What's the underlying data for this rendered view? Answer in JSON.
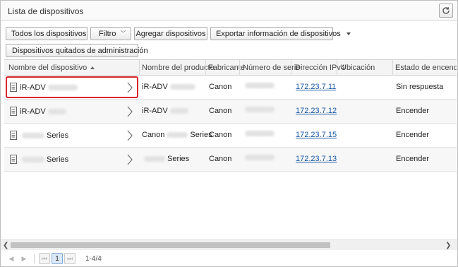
{
  "window": {
    "title": "Lista de dispositivos"
  },
  "toolbar": {
    "all_devices": "Todos los dispositivos",
    "filter": "Filtro",
    "add_devices": "Agregar dispositivos",
    "export": "Exportar información de dispositivos",
    "removed_devices": "Dispositivos quitados de administración"
  },
  "columns": [
    "Nombre del dispositivo",
    "Nombre del producto",
    "Fabricante",
    "Número de serie",
    "Dirección IPv4",
    "Ubicación",
    "Estado de encendido"
  ],
  "rows": [
    {
      "name_prefix": "iR-ADV",
      "name_suffix": "",
      "product_prefix": "iR-ADV",
      "product_suffix": "",
      "maker": "Canon",
      "ip": "172.23.7.11",
      "status": "Sin respuesta"
    },
    {
      "name_prefix": "iR-ADV",
      "name_suffix": "",
      "product_prefix": "iR-ADV",
      "product_suffix": "",
      "maker": "Canon",
      "ip": "172.23.7.12",
      "status": "Encender"
    },
    {
      "name_prefix": "",
      "name_suffix": "Series",
      "product_prefix": "Canon",
      "product_suffix": "Series",
      "maker": "Canon",
      "ip": "172.23.7.15",
      "status": "Encender"
    },
    {
      "name_prefix": "",
      "name_suffix": "Series",
      "product_prefix": "",
      "product_suffix": "Series",
      "maker": "Canon",
      "ip": "172.23.7.13",
      "status": "Encender"
    }
  ],
  "pager": {
    "page": "1",
    "info": "1-4/4"
  },
  "colors": {
    "highlight": "#d9252a",
    "link": "#1a5aa6"
  }
}
